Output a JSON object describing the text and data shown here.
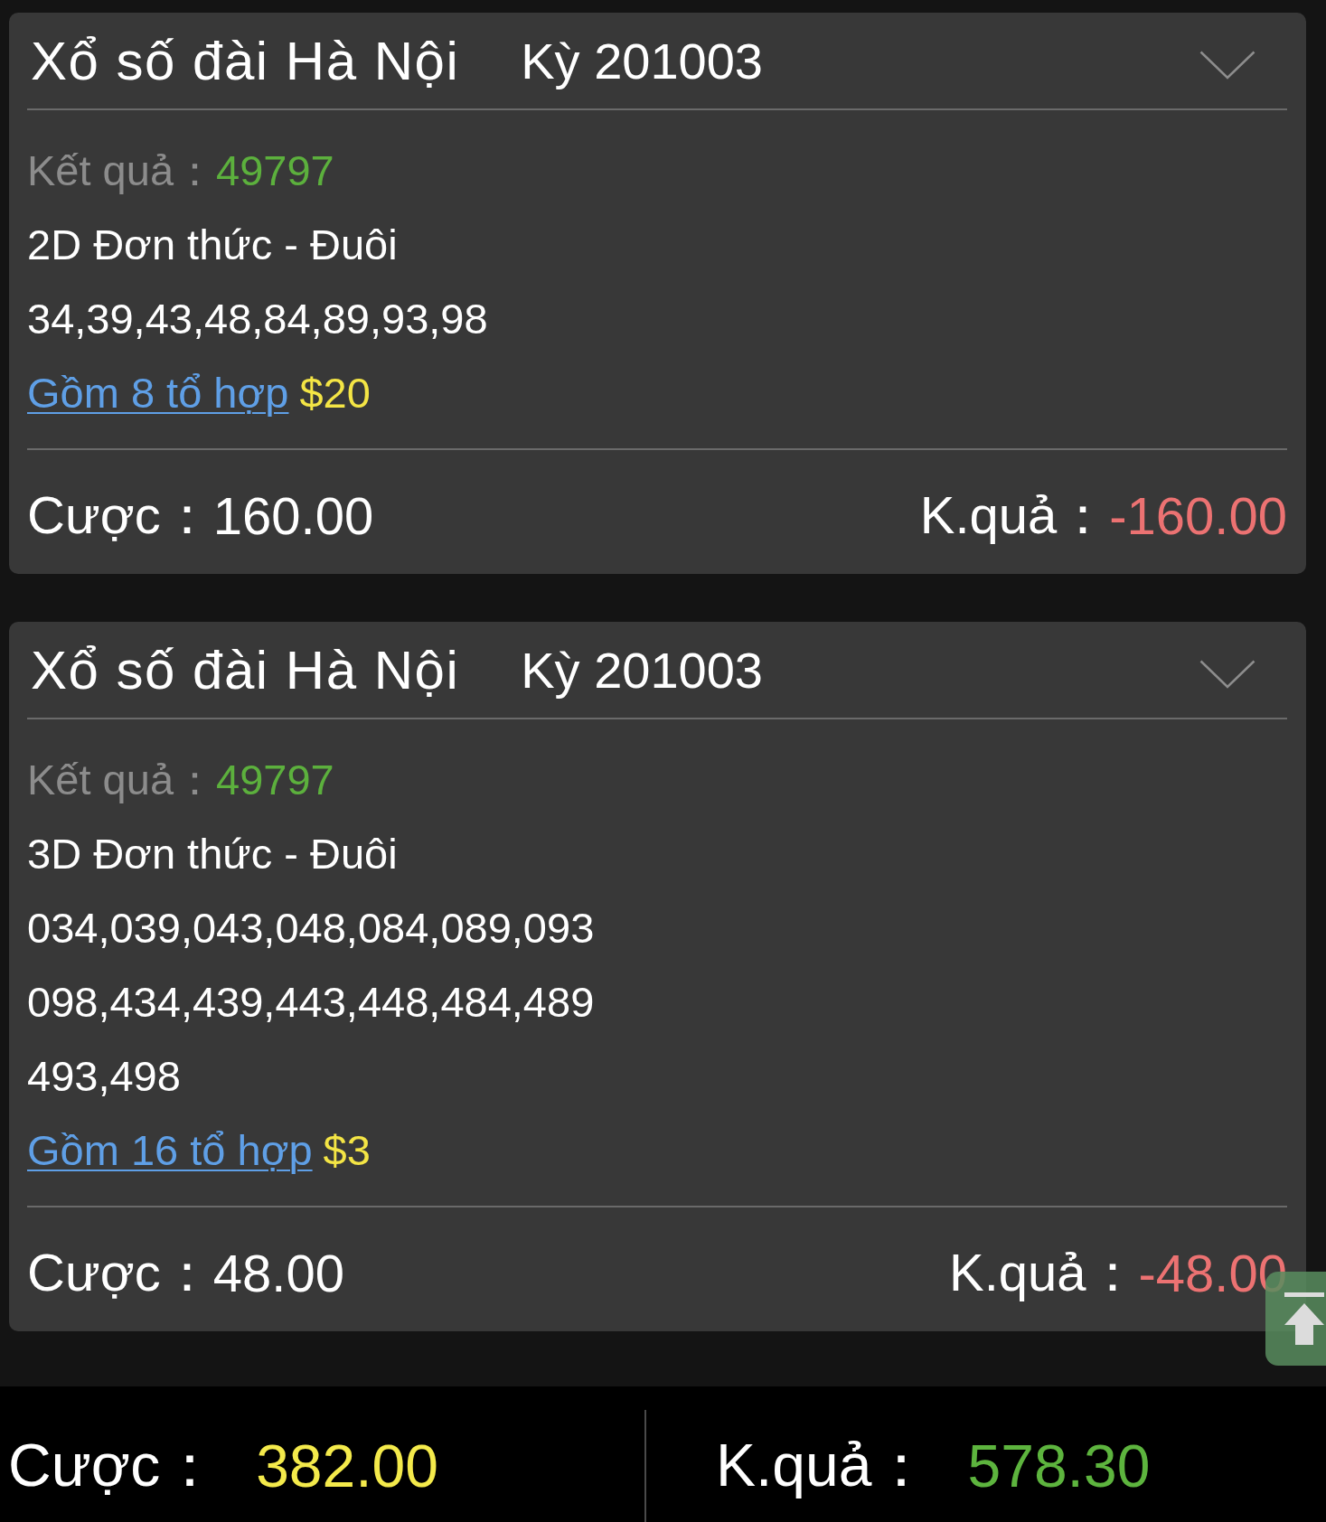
{
  "tickets": [
    {
      "lottery": "Xổ số đài Hà Nội",
      "period": "Kỳ 201003",
      "result_label": "Kết quả：",
      "result": "49797",
      "bet_type": "2D Đơn thức - Đuôi",
      "number_lines": [
        "34,39,43,48,84,89,93,98"
      ],
      "combo_link": "Gồm 8 tổ hợp",
      "unit_price": "$20",
      "bet_label": "Cược：",
      "bet_amount": "160.00",
      "payout_label": "K.quả：",
      "payout": "-160.00"
    },
    {
      "lottery": "Xổ số đài Hà Nội",
      "period": "Kỳ 201003",
      "result_label": "Kết quả：",
      "result": "49797",
      "bet_type": "3D Đơn thức - Đuôi",
      "number_lines": [
        "034,039,043,048,084,089,093",
        "098,434,439,443,448,484,489",
        "493,498"
      ],
      "combo_link": "Gồm 16 tổ hợp",
      "unit_price": "$3",
      "bet_label": "Cược：",
      "bet_amount": "48.00",
      "payout_label": "K.quả：",
      "payout": "-48.00"
    }
  ],
  "summary": {
    "bet_label": "Cược：",
    "bet_total": "382.00",
    "payout_label": "K.quả：",
    "payout_total": "578.30"
  }
}
